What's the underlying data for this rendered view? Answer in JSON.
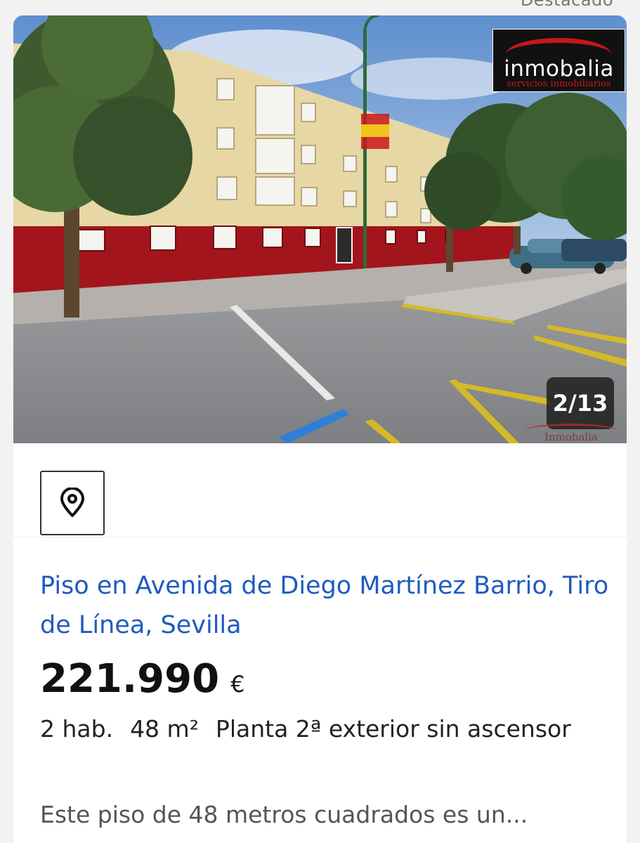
{
  "header": {
    "featured_label": "Destacado"
  },
  "photo": {
    "logo": {
      "name": "inmobalia",
      "tagline": "servicios inmobiliarios"
    },
    "counter": "2/13",
    "watermark": "Inmobalia"
  },
  "map_button": {
    "icon": "location-pin-icon"
  },
  "listing": {
    "title": "Piso en Avenida de Diego Martínez Barrio, Tiro de Línea, Sevilla",
    "price": "221.990",
    "currency": "€",
    "rooms": "2 hab.",
    "area": "48 m²",
    "floor": "Planta 2ª exterior sin ascensor",
    "description": "Este piso de 48 metros cuadrados es un..."
  },
  "colors": {
    "title_link": "#1f5bbf",
    "brand_red": "#c8161d",
    "facade_red": "#a3151c",
    "facade_yellow": "#e7d7a4"
  }
}
